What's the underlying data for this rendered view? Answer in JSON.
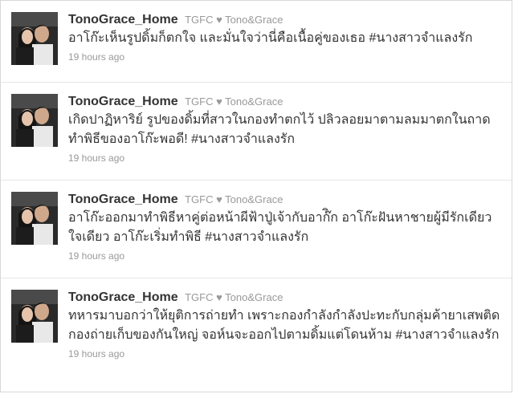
{
  "tweets": [
    {
      "screen_name": "TonoGrace_Home",
      "full_name": "TGFC ♥ Tono&Grace",
      "text": "อาโก๊ะเห็นรูปดิ้มก็ตกใจ และมั่นใจว่านี่คือเนื้อคู่ของเธอ #นางสาวจำแลงรัก",
      "time": "19 hours ago",
      "avatar_icon": "profile-photo-couple"
    },
    {
      "screen_name": "TonoGrace_Home",
      "full_name": "TGFC ♥ Tono&Grace",
      "text": "เกิดปาฏิหาริย์ รูปของดิ้มที่สาวในกองทำตกไว้ ปลิวลอยมาตามลมมาตกในถาดทำพิธีของอาโก๊ะพอดี! #นางสาวจำแลงรัก",
      "time": "19 hours ago",
      "avatar_icon": "profile-photo-couple"
    },
    {
      "screen_name": "TonoGrace_Home",
      "full_name": "TGFC ♥ Tono&Grace",
      "text": "อาโก๊ะออกมาทำพิธีหาคู่ต่อหน้าผีฟ้าปู่เจ้ากับอาก๊ิก อาโก๊ะฝันหาชายผู้มีรักเดียวใจเดียว อาโก๊ะเริ่มทำพิธี #นางสาวจำแลงรัก",
      "time": "19 hours ago",
      "avatar_icon": "profile-photo-couple"
    },
    {
      "screen_name": "TonoGrace_Home",
      "full_name": "TGFC ♥ Tono&Grace",
      "text": "ทหารมาบอกว่าให้ยุติการถ่ายทำ เพราะกองกำลังกำลังปะทะกับกลุ่มค้ายาเสพติด กองถ่ายเก็บของกันใหญ่ จอห์นจะออกไปตามดิ้มแต่โดนห้าม #นางสาวจำแลงรัก",
      "time": "19 hours ago",
      "avatar_icon": "profile-photo-couple"
    }
  ]
}
